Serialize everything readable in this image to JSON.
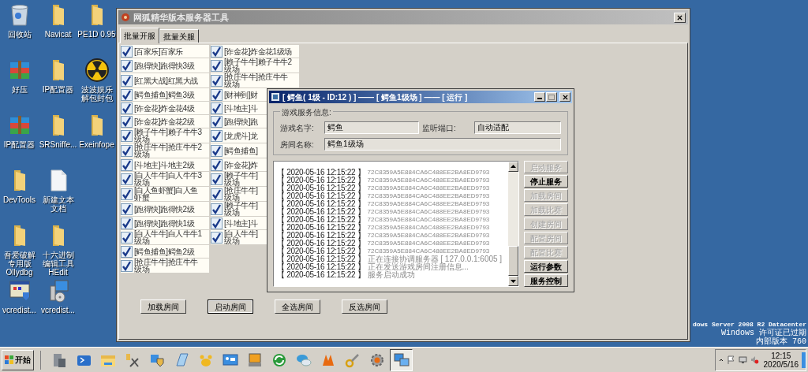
{
  "desktop_icons": [
    {
      "kind": "recycle-bin",
      "label": "回收站"
    },
    {
      "kind": "archive",
      "label": "好压"
    },
    {
      "kind": "archive",
      "label": "IP配置器"
    },
    {
      "kind": "folder",
      "label": "DevTools"
    },
    {
      "kind": "folder",
      "label": "吾爱破解专用版Ollydbg"
    },
    {
      "kind": "installer",
      "label": "vcredist..."
    },
    {
      "kind": "folder",
      "label": "Navicat"
    },
    {
      "kind": "folder",
      "label": "IP配置器"
    },
    {
      "kind": "folder",
      "label": "SRSniffe..."
    },
    {
      "kind": "document",
      "label": "新建文本文档"
    },
    {
      "kind": "folder",
      "label": "十六进制编辑工具HEdit"
    },
    {
      "kind": "setup",
      "label": "vcredist..."
    },
    {
      "kind": "folder",
      "label": "PE1D 0.95"
    },
    {
      "kind": "hazard",
      "label": "波波娱乐解包封包"
    },
    {
      "kind": "folder",
      "label": "Exeinfope"
    }
  ],
  "main_window": {
    "title": "网狐精华版本服务器工具",
    "tabs": [
      {
        "label": "批量开服",
        "selected": true
      },
      {
        "label": "批量关服",
        "selected": false
      }
    ],
    "rooms": [
      {
        "lines": [
          "[百家乐]百家乐"
        ],
        "checked": true
      },
      {
        "lines": [
          "[跑得快]跑得快3级"
        ],
        "checked": true
      },
      {
        "lines": [
          "[红黑大战]红黑大战"
        ],
        "checked": true
      },
      {
        "lines": [
          "[鳄鱼捕鱼]鳄鱼3级"
        ],
        "checked": true
      },
      {
        "lines": [
          "[诈金花]炸金花4级"
        ],
        "checked": true
      },
      {
        "lines": [
          "[诈金花]炸金花2级"
        ],
        "checked": true
      },
      {
        "lines": [
          "[赖子牛牛]赖子牛牛3",
          "级场"
        ],
        "checked": true
      },
      {
        "lines": [
          "[抢庄牛牛]抢庄牛牛2",
          "级场"
        ],
        "checked": true
      },
      {
        "lines": [
          "[斗地主]斗地主2级"
        ],
        "checked": true
      },
      {
        "lines": [
          "[白人牛牛]白人牛牛3",
          "级场"
        ],
        "checked": true
      },
      {
        "lines": [
          "[白人鱼虾蟹]白人鱼",
          "虾蟹"
        ],
        "checked": true
      },
      {
        "lines": [
          "[跑得快]跑得快2级"
        ],
        "checked": true
      },
      {
        "lines": [
          "[跑得快]跑得快1级"
        ],
        "checked": true
      },
      {
        "lines": [
          "[白人牛牛]白人牛牛1",
          "级场"
        ],
        "checked": true
      },
      {
        "lines": [
          "[鳄鱼捕鱼]鳄鱼2级"
        ],
        "checked": true
      },
      {
        "lines": [
          "[抢庄牛牛]抢庄牛牛",
          "级场"
        ],
        "checked": true
      },
      {
        "lines": [
          "[诈金花]炸金花1级场"
        ],
        "checked": true
      },
      {
        "lines": [
          "[赖子牛牛]赖子牛牛2",
          "级场"
        ],
        "checked": true
      },
      {
        "lines": [
          "[抢庄牛牛]抢庄牛牛",
          "级场"
        ],
        "checked": true
      },
      {
        "lines": [
          "[财神到]财"
        ],
        "checked": true
      },
      {
        "lines": [
          "[斗地主]斗"
        ],
        "checked": true
      },
      {
        "lines": [
          "[跑得快]跑"
        ],
        "checked": true
      },
      {
        "lines": [
          "[龙虎斗]龙"
        ],
        "checked": true
      },
      {
        "lines": [
          "[鳄鱼捕鱼]"
        ],
        "checked": true
      },
      {
        "lines": [
          "[诈金花]炸"
        ],
        "checked": true
      },
      {
        "lines": [
          "[赖子牛牛]",
          "级场"
        ],
        "checked": true
      },
      {
        "lines": [
          "[抢庄牛牛]",
          "级场"
        ],
        "checked": true
      },
      {
        "lines": [
          "[赖子牛牛]",
          "级场"
        ],
        "checked": true
      },
      {
        "lines": [
          "[斗地主]斗"
        ],
        "checked": true
      },
      {
        "lines": [
          "[白人牛牛]",
          "级场"
        ],
        "checked": true
      }
    ],
    "buttons": [
      {
        "label": "加载房间",
        "focused": false
      },
      {
        "label": "启动房间",
        "focused": true
      },
      {
        "label": "全选房间",
        "focused": false
      },
      {
        "label": "反选房间",
        "focused": false
      }
    ]
  },
  "dialog": {
    "title": "[ 鳄鱼( 1级 - ID:12 ) ] —— [ 鳄鱼1级场 ] —— [ 运行 ]",
    "group_title": "游戏服务信息:",
    "fields": [
      {
        "label": "游戏名字:",
        "value": "鳄鱼"
      },
      {
        "label": "监听端口:",
        "value": "自动适配"
      },
      {
        "label": "房间名称:",
        "value": "鳄鱼1级场"
      }
    ],
    "log": [
      {
        "time": "【 2020-05-16 12:15:22 】",
        "message": "72C8359A5E884CA6C488EE2BA8ED9793",
        "kind": "hash"
      },
      {
        "time": "【 2020-05-16 12:15:22 】",
        "message": "72C8359A5E884CA6C488EE2BA8ED9793",
        "kind": "hash"
      },
      {
        "time": "【 2020-05-16 12:15:22 】",
        "message": "72C8359A5E884CA6C488EE2BA8ED9793",
        "kind": "hash"
      },
      {
        "time": "【 2020-05-16 12:15:22 】",
        "message": "72C8359A5E884CA6C488EE2BA8ED9793",
        "kind": "hash"
      },
      {
        "time": "【 2020-05-16 12:15:22 】",
        "message": "72C8359A5E884CA6C488EE2BA8ED9793",
        "kind": "hash"
      },
      {
        "time": "【 2020-05-16 12:15:22 】",
        "message": "72C8359A5E884CA6C488EE2BA8ED9793",
        "kind": "hash"
      },
      {
        "time": "【 2020-05-16 12:15:22 】",
        "message": "72C8359A5E884CA6C488EE2BA8ED9793",
        "kind": "hash"
      },
      {
        "time": "【 2020-05-16 12:15:22 】",
        "message": "72C8359A5E884CA6C488EE2BA8ED9793",
        "kind": "hash"
      },
      {
        "time": "【 2020-05-16 12:15:22 】",
        "message": "72C8359A5E884CA6C488EE2BA8ED9793",
        "kind": "hash"
      },
      {
        "time": "【 2020-05-16 12:15:22 】",
        "message": "72C8359A5E884CA6C488EE2BA8ED9793",
        "kind": "hash"
      },
      {
        "time": "【 2020-05-16 12:15:22 】",
        "message": "72C8359A5E884CA6C488EE2BA8ED9793",
        "kind": "hash"
      },
      {
        "time": "【 2020-05-16 12:15:22 】",
        "message": "正在连接协调服务器 [ 127.0.0.1:6005 ]",
        "kind": "status"
      },
      {
        "time": "【 2020-05-16 12:15:22 】",
        "message": "正在发送游戏房间注册信息...",
        "kind": "status"
      },
      {
        "time": "【 2020-05-16 12:15:22 】",
        "message": "服务启动成功",
        "kind": "status"
      }
    ],
    "buttons": [
      {
        "label": "启动服务",
        "disabled": true
      },
      {
        "label": "停止服务",
        "disabled": false
      },
      {
        "label": "加载房间",
        "disabled": true
      },
      {
        "label": "加载比赛",
        "disabled": true
      },
      {
        "label": "创建房间",
        "disabled": true
      },
      {
        "label": "配置房间",
        "disabled": true
      },
      {
        "label": "配置比赛",
        "disabled": true
      },
      {
        "label": "运行参数",
        "disabled": false
      },
      {
        "label": "服务控制",
        "disabled": false
      }
    ]
  },
  "os_notice": [
    "dows Server 2008 R2 Datacenter",
    "Windows 许可证已过期",
    "内部版本 760"
  ],
  "taskbar": {
    "start": "开始",
    "apps": [
      {
        "kind": "server",
        "selected": false
      },
      {
        "kind": "terminal",
        "selected": false
      },
      {
        "kind": "folder",
        "selected": false
      },
      {
        "kind": "tools",
        "selected": false
      },
      {
        "kind": "shield",
        "selected": false
      },
      {
        "kind": "notepad",
        "selected": false
      },
      {
        "kind": "paw",
        "selected": false
      },
      {
        "kind": "remote",
        "selected": false
      },
      {
        "kind": "computer",
        "selected": false
      },
      {
        "kind": "arrows",
        "selected": false
      },
      {
        "kind": "chat",
        "selected": false
      },
      {
        "kind": "vs",
        "selected": false
      },
      {
        "kind": "key",
        "selected": false
      },
      {
        "kind": "gear",
        "selected": false
      },
      {
        "kind": "network",
        "selected": true
      }
    ],
    "time": "12:15",
    "date": "2020/5/16"
  }
}
